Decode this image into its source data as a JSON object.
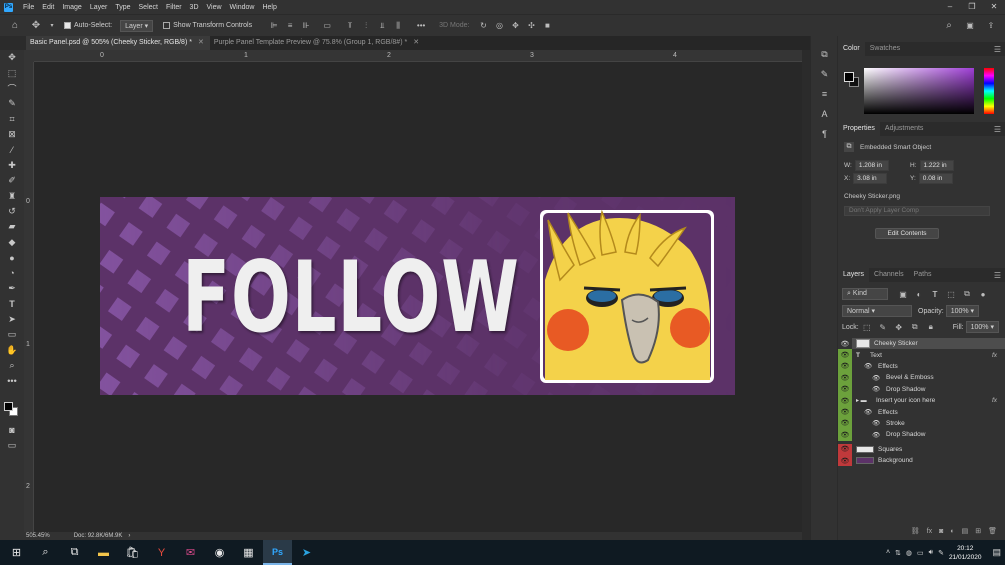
{
  "app": {
    "logo": "Ps"
  },
  "menu": [
    "File",
    "Edit",
    "Image",
    "Layer",
    "Type",
    "Select",
    "Filter",
    "3D",
    "View",
    "Window",
    "Help"
  ],
  "window_controls": [
    "–",
    "❐",
    "✕"
  ],
  "options_bar": {
    "auto_select_label": "Auto-Select:",
    "auto_select_checked": true,
    "target_value": "Layer",
    "transform_label": "Show Transform Controls",
    "transform_checked": false,
    "mode_label": "3D Mode:"
  },
  "tabs": [
    {
      "title": "Basic Panel.psd @ 505% (Cheeky Sticker, RGB/8) *",
      "active": true
    },
    {
      "title": "Purple Panel Template Preview @ 75.8% (Group 1, RGB/8#) *",
      "active": false
    }
  ],
  "ruler_h": [
    "0",
    "1",
    "2",
    "3",
    "4"
  ],
  "ruler_v": [
    "0",
    "1",
    "2"
  ],
  "canvas": {
    "follow_text": "FOLLOW",
    "background_color": "#5c3268",
    "text_color": "#efefef"
  },
  "status": {
    "zoom": "505.45%",
    "doc": "Doc: 92.8K/6M.9K"
  },
  "color_panel": {
    "tabs": [
      "Color",
      "Swatches"
    ],
    "hue_color": "#9f3fd6"
  },
  "properties_panel": {
    "tabs": [
      "Properties",
      "Adjustments"
    ],
    "object_type": "Embedded Smart Object",
    "w": "1.208 in",
    "h": "1.222 in",
    "x": "3.08 in",
    "y": "0.08 in",
    "filename": "Cheeky Sticker.png",
    "layer_comp": "Don't Apply Layer Comp",
    "edit_button": "Edit Contents"
  },
  "layers_panel": {
    "tabs": [
      "Layers",
      "Channels",
      "Paths"
    ],
    "filter": "Kind",
    "blend_mode": "Normal",
    "opacity_label": "Opacity:",
    "opacity": "100%",
    "lock_label": "Lock:",
    "fill_label": "Fill:",
    "fill": "100%",
    "layers": [
      {
        "name": "Cheeky Sticker",
        "kind": "smart",
        "indent": 0,
        "eye_color": "#323232",
        "selected": true
      },
      {
        "name": "Text",
        "kind": "text",
        "indent": 0,
        "eye_color": "#6ca13c",
        "fx": true
      },
      {
        "name": "Effects",
        "kind": "effects",
        "indent": 1,
        "eye_color": "#6ca13c"
      },
      {
        "name": "Bevel & Emboss",
        "kind": "effect",
        "indent": 2,
        "eye_color": "#6ca13c"
      },
      {
        "name": "Drop Shadow",
        "kind": "effect",
        "indent": 2,
        "eye_color": "#6ca13c"
      },
      {
        "name": "Insert your icon here",
        "kind": "folder",
        "indent": 0,
        "eye_color": "#6ca13c",
        "fx": true
      },
      {
        "name": "Effects",
        "kind": "effects",
        "indent": 1,
        "eye_color": "#6ca13c"
      },
      {
        "name": "Stroke",
        "kind": "effect",
        "indent": 2,
        "eye_color": "#6ca13c"
      },
      {
        "name": "Drop Shadow",
        "kind": "effect",
        "indent": 2,
        "eye_color": "#6ca13c"
      },
      {
        "name": "Squares",
        "kind": "pixel",
        "indent": 0,
        "eye_color": "#c0393b",
        "gap": true
      },
      {
        "name": "Background",
        "kind": "pixel",
        "indent": 0,
        "eye_color": "#c0393b"
      }
    ]
  },
  "taskbar": {
    "time": "20:12",
    "date": "21/01/2020",
    "active_app": "Ps"
  }
}
